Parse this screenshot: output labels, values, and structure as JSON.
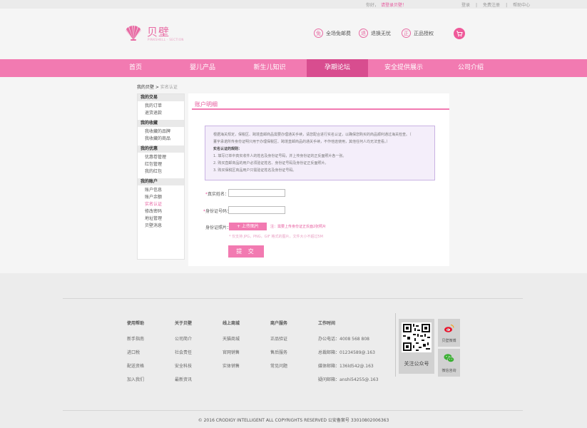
{
  "topbar": {
    "greeting": "你好，",
    "welcome": "请登录贝壁！",
    "links": [
      "登录",
      "|",
      "免费注册",
      "|",
      "帮助中心"
    ]
  },
  "header": {
    "logo_name": "贝壁",
    "logo_sub": "PINKSHELL · SECTION",
    "promos": [
      {
        "icon": "免",
        "label": "全场免邮费"
      },
      {
        "icon": "退",
        "label": "退换无忧"
      },
      {
        "icon": "正",
        "label": "正品授权"
      }
    ],
    "cart_icon": "cart-icon"
  },
  "nav": {
    "items": [
      "首页",
      "婴儿产品",
      "新生儿知识",
      "孕期论坛",
      "安全提供展示",
      "公司介绍"
    ],
    "active_index": 3
  },
  "breadcrumb": {
    "home": "我的贝壁",
    "sep": " > ",
    "current": "实名认证"
  },
  "sidebar": {
    "sections": [
      {
        "title": "我的交易",
        "items": [
          "我的订单",
          "退货退款"
        ]
      },
      {
        "title": "我的收藏",
        "items": [
          "我收藏的品牌",
          "我收藏的商品"
        ]
      },
      {
        "title": "我的优惠",
        "items": [
          "优惠卷管理",
          "红包管理",
          "我的红包"
        ]
      },
      {
        "title": "我的账户",
        "items": [
          "账户信息",
          "账户余额",
          "实名认证",
          "修改密码",
          "地址管理",
          "贝壁消息"
        ]
      }
    ],
    "active_item": "实名认证"
  },
  "main": {
    "title": "账户明细",
    "notice": {
      "lines": [
        "根据海关规定，保税区、跨境直邮商品需要办理通关手续，请您配合进行实名认证，以确保您购买的商品顺利通过海关检查。（",
        "董宇承诺所传身份证明只用于办理保税区、跨境直邮商品的通关手续，不作他途使用，其他任何人均无法查看。）"
      ],
      "rules_title": "实名认证的规则：",
      "rules": [
        "1. 填写订单中真实收件人的姓名及身份证号码，并上传身份证的正反面照片各一张。",
        "2. 购买直邮商品的用户必须验证姓名、身份证号码及身份证正反面照片。",
        "3. 购买保税区商品用户只需验证姓名及身份证号码。"
      ]
    },
    "form": {
      "name_label": "真实姓名：",
      "id_label": "身份证号码：",
      "photo_label": "身份证照片：",
      "required_mark": "*",
      "upload_button": "+ 上传图片",
      "upload_hint": "注：需要上传身份证正反面2张照片",
      "format_hint": "* 仅支持 JPG，PNG，GIF 格式的图片，文件大小不超过5M",
      "submit_button": "提 交"
    }
  },
  "footer": {
    "columns": [
      {
        "title": "使用帮助",
        "items": [
          "新手指南",
          "进口税",
          "配送资格",
          "加入我们"
        ]
      },
      {
        "title": "关于贝壁",
        "items": [
          "公司简介",
          "社会责任",
          "安全科技",
          "最新资讯"
        ]
      },
      {
        "title": "线上商城",
        "items": [
          "天猫商城",
          "官网销售",
          "实体销售"
        ]
      },
      {
        "title": "商户服务",
        "items": [
          "正品验证",
          "售后服务",
          "常见问题"
        ]
      },
      {
        "title": "工作时间",
        "items": [
          "办公电话：4008 568 808",
          "总裁邮箱：01234589@.163",
          "媒体邮箱：136ld542@.163",
          "疑问邮箱：anshi54255@.163"
        ]
      }
    ],
    "qr_label": "关注公众号",
    "social": [
      {
        "icon": "weibo-icon",
        "label": "贝壁微博"
      },
      {
        "icon": "wechat-icon",
        "label": "微信咨询"
      }
    ],
    "copyright": "©  2016  CRODIGY INTELLIGENT ALL COPYRIGHTS RESERVED    公安备案号 33010802006363"
  },
  "colors": {
    "accent": "#f27ab1",
    "accent_dark": "#d84d8f",
    "notice_bg": "#f4eefa"
  }
}
